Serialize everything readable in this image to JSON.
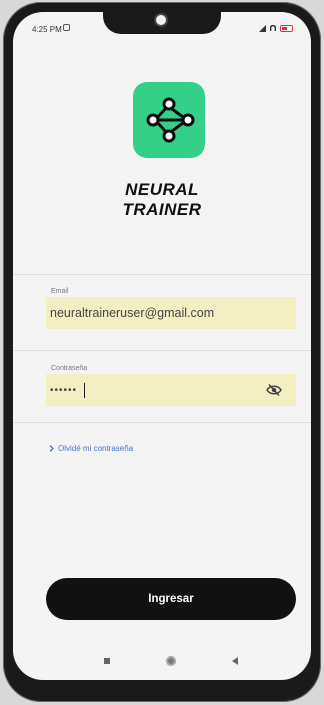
{
  "status_bar": {
    "time": "4:25 PM"
  },
  "app": {
    "brand_line1": "NEURAL",
    "brand_line2": "TRAINER",
    "logo_color": "#34d08a"
  },
  "form": {
    "email": {
      "label": "Email",
      "value": "neuraltraineruser@gmail.com"
    },
    "password": {
      "label": "Contraseña",
      "value": "••••••"
    },
    "forgot_link": "Olvidé mi contraseña",
    "field_bg_color": "#f4efc3"
  },
  "login_button": {
    "label": "Ingresar",
    "color": "#111111"
  },
  "icons": {
    "logo": "neural-network-icon",
    "password_toggle": "eye-off-icon",
    "forgot_chevron": "chevron-right-icon",
    "nav": [
      "recent-apps-icon",
      "home-icon",
      "back-icon"
    ]
  }
}
